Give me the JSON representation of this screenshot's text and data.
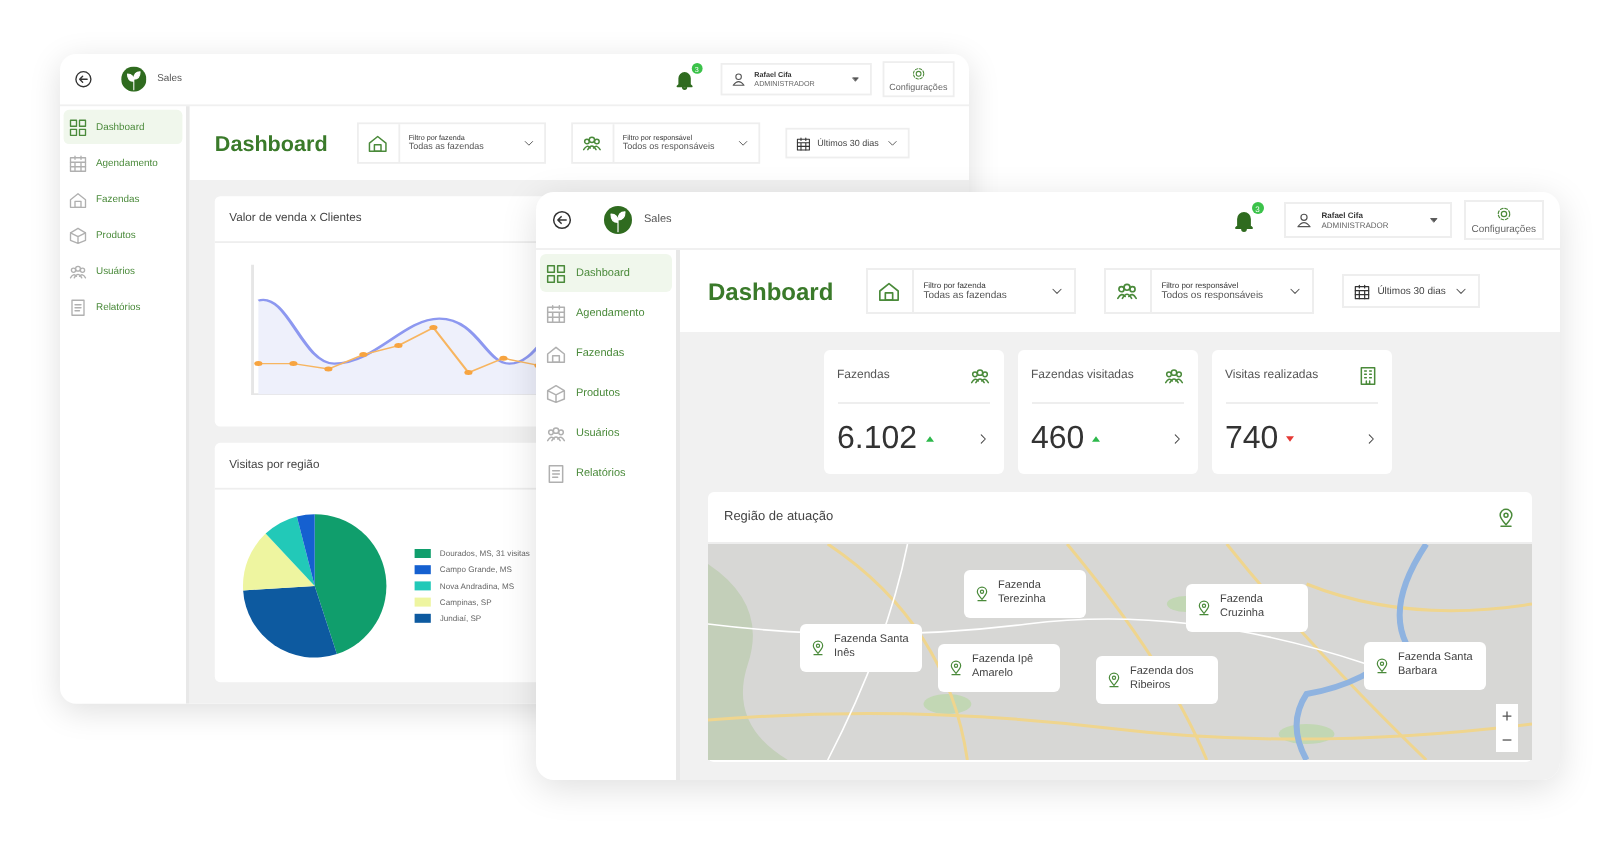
{
  "windows": [
    {
      "header": {
        "app": "Sales",
        "badge": "3",
        "user": "Rafael Cifa",
        "role": "ADMINISTRADOR",
        "settings": "Configurações"
      },
      "sidebar": [
        {
          "label": "Dashboard",
          "selected": true
        },
        {
          "label": "Agendamento",
          "selected": false
        },
        {
          "label": "Fazendas",
          "selected": false
        },
        {
          "label": "Produtos",
          "selected": false
        },
        {
          "label": "Usuários",
          "selected": false
        },
        {
          "label": "Relatórios",
          "selected": false
        }
      ],
      "title": "Dashboard",
      "filters": [
        {
          "label": "Filtro por fazenda",
          "value": "Todas as fazendas"
        },
        {
          "label": "Filtro por responsável",
          "value": "Todos os responsáveis"
        }
      ],
      "period": "Últimos 30 dias",
      "panels": [
        {
          "kind": "line",
          "title": "Valor de venda x Clientes"
        },
        {
          "kind": "pie",
          "title": "Visitas por região",
          "legend": [
            {
              "label": "Dourados, MS, 31 visitas",
              "color": "#109e6c"
            },
            {
              "label": "Campo Grande, MS",
              "color": "#1560d0"
            },
            {
              "label": "Nova Andradina, MS",
              "color": "#22c9b8"
            },
            {
              "label": "Campinas, SP",
              "color": "#eef5a0"
            },
            {
              "label": "Jundiaí, SP",
              "color": "#0d5aa0"
            }
          ]
        }
      ]
    },
    {
      "header": {
        "app": "Sales",
        "badge": "3",
        "user": "Rafael Cifa",
        "role": "ADMINISTRADOR",
        "settings": "Configurações"
      },
      "sidebar": [
        {
          "label": "Dashboard",
          "selected": true
        },
        {
          "label": "Agendamento",
          "selected": false
        },
        {
          "label": "Fazendas",
          "selected": false
        },
        {
          "label": "Produtos",
          "selected": false
        },
        {
          "label": "Usuários",
          "selected": false
        },
        {
          "label": "Relatórios",
          "selected": false
        }
      ],
      "title": "Dashboard",
      "filters": [
        {
          "label": "Filtro por fazenda",
          "value": "Todas as fazendas"
        },
        {
          "label": "Filtro por responsável",
          "value": "Todos os responsáveis"
        }
      ],
      "period": "Últimos 30 dias",
      "stats": [
        {
          "label": "Fazendas",
          "value": "6.102",
          "rising": true
        },
        {
          "label": "Fazendas visitadas",
          "value": "460",
          "rising": true
        },
        {
          "label": "Visitas realizadas",
          "value": "740",
          "rising": false
        }
      ],
      "panels": [
        {
          "kind": "map",
          "title": "Região de atuação",
          "zoom_in": "+",
          "zoom_out": "−",
          "markers": [
            {
              "label": "Fazenda Terezinha"
            },
            {
              "label": "Fazenda Cruzinha"
            },
            {
              "label": "Fazenda Santa Inês"
            },
            {
              "label": "Fazenda Ipê Amarelo"
            },
            {
              "label": "Fazenda dos Ribeiros"
            },
            {
              "label": "Fazenda Santa Barbara"
            }
          ]
        }
      ]
    }
  ]
}
